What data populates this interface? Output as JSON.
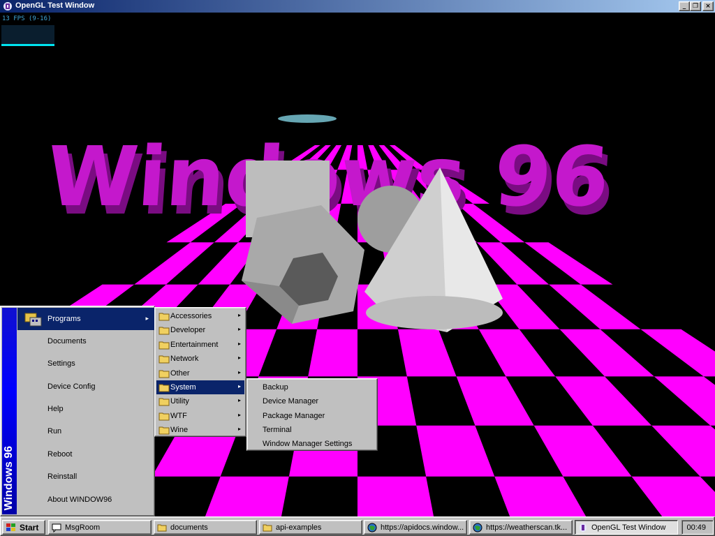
{
  "window": {
    "title": "OpenGL Test Window",
    "icon": "opengl-app-icon",
    "controls": {
      "minimize": "_",
      "maximize": "❐",
      "close": "×"
    }
  },
  "scene": {
    "fps_text": "13 FPS (9-16)",
    "fps_level": 1.0,
    "text_3d": "Windows 96",
    "colors": {
      "magenta": "#ff00ff",
      "text_purple": "#c014c8",
      "shape_gray": "#c8c8c8",
      "fps_cyan": "#00e4f0"
    }
  },
  "start_menu": {
    "banner": "Windows 96",
    "items": [
      {
        "label": "Programs",
        "has_submenu": true,
        "icon": "programs-icon"
      },
      {
        "label": "Documents"
      },
      {
        "label": "Settings"
      },
      {
        "label": "Device Config"
      },
      {
        "label": "Help"
      },
      {
        "label": "Run"
      },
      {
        "label": "Reboot"
      },
      {
        "label": "Reinstall"
      },
      {
        "label": "About WINDOW96"
      }
    ]
  },
  "programs_menu": {
    "items": [
      {
        "label": "Accessories"
      },
      {
        "label": "Developer"
      },
      {
        "label": "Entertainment"
      },
      {
        "label": "Network"
      },
      {
        "label": "Other"
      },
      {
        "label": "System"
      },
      {
        "label": "Utility"
      },
      {
        "label": "WTF"
      },
      {
        "label": "Wine"
      }
    ],
    "selected": "System"
  },
  "system_menu": {
    "items": [
      {
        "label": "Backup"
      },
      {
        "label": "Device Manager"
      },
      {
        "label": "Package Manager"
      },
      {
        "label": "Terminal"
      },
      {
        "label": "Window Manager Settings"
      }
    ]
  },
  "taskbar": {
    "start_label": "Start",
    "tasks": [
      {
        "label": "MsgRoom",
        "icon": "chat-icon"
      },
      {
        "label": "documents",
        "icon": "folder-icon"
      },
      {
        "label": "api-examples",
        "icon": "folder-icon"
      },
      {
        "label": "https://apidocs.window...",
        "icon": "browser-icon"
      },
      {
        "label": "https://weatherscan.tk...",
        "icon": "browser-icon"
      },
      {
        "label": "OpenGL Test Window",
        "icon": "opengl-app-icon",
        "active": true
      }
    ],
    "clock": "00:49"
  }
}
